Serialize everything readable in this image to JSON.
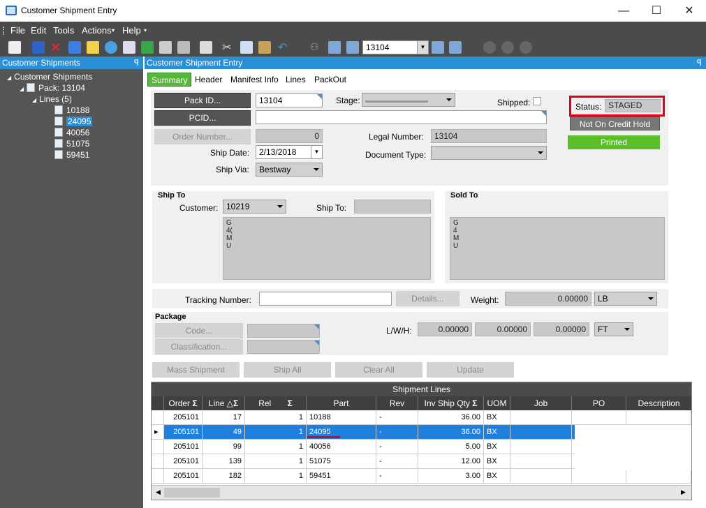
{
  "window": {
    "title": "Customer Shipment Entry",
    "min": "—",
    "max": "☐",
    "close": "✕"
  },
  "menu": [
    "File",
    "Edit",
    "Tools",
    "Actions",
    "Help"
  ],
  "toolbar": {
    "key_value": "13104"
  },
  "left": {
    "header": "Customer Shipments",
    "pin": "ꟼ",
    "root": "Customer Shipments",
    "pack": "Pack: 13104",
    "lines": "Lines (5)",
    "parts": [
      "10188",
      "24095",
      "40056",
      "51075",
      "59451"
    ],
    "selected_part": "24095"
  },
  "right": {
    "header": "Customer Shipment Entry",
    "pin": "ꟼ"
  },
  "tabs": [
    "Summary",
    "Header",
    "Manifest Info",
    "Lines",
    "PackOut"
  ],
  "form": {
    "pack_id_btn": "Pack ID...",
    "pack_id": "13104",
    "pcid_btn": "PCID...",
    "pcid": "",
    "order_btn": "Order Number...",
    "order": "0",
    "ship_date_lbl": "Ship Date:",
    "ship_date": "2/13/2018",
    "ship_via_lbl": "Ship Via:",
    "ship_via": "Bestway",
    "stage_lbl": "Stage:",
    "legal_lbl": "Legal Number:",
    "legal": "13104",
    "doctype_lbl": "Document Type:",
    "doctype": "",
    "shipped_lbl": "Shipped:",
    "status_lbl": "Status:",
    "status": "STAGED",
    "credit": "Not On Credit Hold",
    "printed": "Printed"
  },
  "shipto": {
    "title": "Ship To",
    "customer_lbl": "Customer:",
    "customer": "10219",
    "shipto_lbl": "Ship To:",
    "addr": [
      "G",
      "4(",
      "M",
      "U"
    ]
  },
  "soldto": {
    "title": "Sold To",
    "addr": [
      "G",
      "4",
      "M",
      "U"
    ]
  },
  "tracking": {
    "lbl": "Tracking Number:",
    "value": "",
    "details": "Details...",
    "weight_lbl": "Weight:",
    "weight": "0.00000",
    "weight_uom": "LB"
  },
  "package": {
    "title": "Package",
    "code": "Code...",
    "classif": "Classification...",
    "lwh_lbl": "L/W/H:",
    "l": "0.00000",
    "w": "0.00000",
    "h": "0.00000",
    "uom": "FT"
  },
  "actions": [
    "Mass Shipment",
    "Ship All",
    "Clear All",
    "Update"
  ],
  "grid": {
    "title": "Shipment Lines",
    "columns": [
      "Order",
      "Line",
      "Rel",
      "Part",
      "Rev",
      "Inv Ship Qty",
      "UOM",
      "Job",
      "PO",
      "Description"
    ],
    "rows": [
      [
        "205101",
        "17",
        "1",
        "10188",
        "-",
        "36.00",
        "BX",
        "",
        "",
        ""
      ],
      [
        "205101",
        "49",
        "1",
        "24095",
        "-",
        "36.00",
        "BX",
        "",
        "",
        ""
      ],
      [
        "205101",
        "99",
        "1",
        "40056",
        "-",
        "5.00",
        "BX",
        "",
        "",
        ""
      ],
      [
        "205101",
        "139",
        "1",
        "51075",
        "-",
        "12.00",
        "BX",
        "",
        "",
        ""
      ],
      [
        "205101",
        "182",
        "1",
        "59451",
        "-",
        "3.00",
        "BX",
        "",
        "",
        ""
      ]
    ]
  },
  "colors": {
    "accent": "#2b8fd6",
    "printed": "#5cbf2a",
    "status_border": "#e0001a",
    "selected_row": "#1f7fdc"
  }
}
